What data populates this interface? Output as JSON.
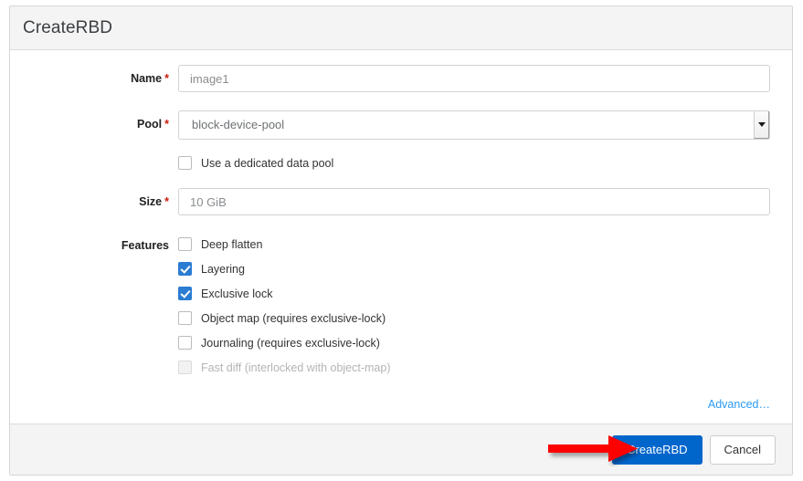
{
  "modal": {
    "title": "CreateRBD",
    "fields": {
      "name": {
        "label": "Name",
        "required_marker": "*",
        "value": "image1",
        "placeholder": "image1"
      },
      "pool": {
        "label": "Pool",
        "required_marker": "*",
        "value": "block-device-pool"
      },
      "size": {
        "label": "Size",
        "required_marker": "*",
        "value": "10 GiB",
        "placeholder": "10 GiB"
      },
      "features": {
        "label": "Features"
      }
    },
    "dedicated_pool": {
      "label": "Use a dedicated data pool",
      "checked": false
    },
    "feature_items": [
      {
        "label": "Deep flatten",
        "checked": false,
        "disabled": false
      },
      {
        "label": "Layering",
        "checked": true,
        "disabled": false
      },
      {
        "label": "Exclusive lock",
        "checked": true,
        "disabled": false
      },
      {
        "label": "Object map (requires exclusive-lock)",
        "checked": false,
        "disabled": false
      },
      {
        "label": "Journaling (requires exclusive-lock)",
        "checked": false,
        "disabled": false
      },
      {
        "label": "Fast diff (interlocked with object-map)",
        "checked": false,
        "disabled": true
      }
    ],
    "advanced_link": "Advanced…",
    "footer": {
      "submit_label": "CreateRBD",
      "cancel_label": "Cancel"
    }
  },
  "colors": {
    "primary_button": "#0066cc",
    "checkbox_checked": "#2b7cd3",
    "link": "#2b9af3",
    "required_star": "#c9190b",
    "annotation_arrow": "#ff0000",
    "header_bg": "#f4f4f4"
  },
  "annotation": {
    "arrow": "right-arrow",
    "points_to": "CreateRBD"
  }
}
